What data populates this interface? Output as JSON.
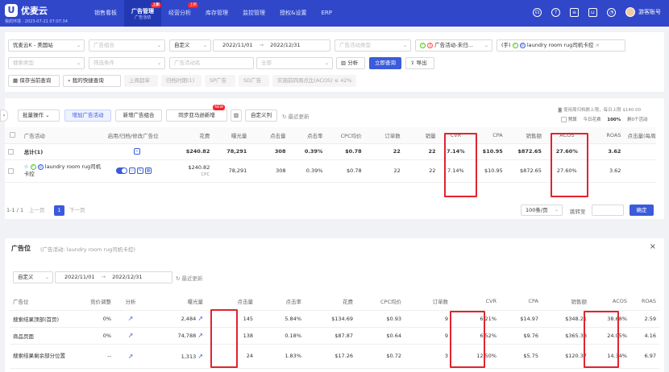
{
  "app": {
    "name": "优麦云",
    "subtitle": "我的环境 · 2023-07-21 07:07:34"
  },
  "nav": [
    {
      "label": "销售看板",
      "sub": "",
      "badge": ""
    },
    {
      "label": "广告管理",
      "sub": "广告活动",
      "badge": "上新"
    },
    {
      "label": "经营分析",
      "sub": "",
      "badge": "上新"
    },
    {
      "label": "库存管理",
      "sub": "",
      "badge": ""
    },
    {
      "label": "监控管理",
      "sub": "",
      "badge": ""
    },
    {
      "label": "授权&设置",
      "sub": "",
      "badge": ""
    },
    {
      "label": "ERP",
      "sub": "",
      "badge": ""
    }
  ],
  "user": {
    "name": "游客账号"
  },
  "filters": {
    "store": "优麦云K - 美国站",
    "portfolio_ph": "广告组合",
    "date_mode": "自定义",
    "date_start": "2022/11/01",
    "date_arrow": "→",
    "date_end": "2022/12/31",
    "ad_type_ph": "广告活动类型",
    "status_chip": "广告活动-未归…",
    "tag_chip_prefix": "(手)",
    "tag_chip": "laundry room rug司机卡控",
    "search_type_ph": "搜索类型",
    "search_cond_ph": "筛选条件",
    "campaign_ph": "广告活动名",
    "unit_ph": "全部",
    "analyze_btn": "分析",
    "query_btn": "立即查询",
    "export_btn": "导出",
    "save_btn": "保存当前查询",
    "my_query_btn": "我的快捷查询",
    "quick_tags": [
      "上周超单",
      "归档时期(1)",
      "SP广告",
      "SD广告",
      "实施前四周点比(ACOS) ≤ 42%"
    ]
  },
  "toolbar": {
    "batch_btn": "批量操作",
    "add_campaign_btn": "增加广告活动",
    "add_portfolio_btn": "新增广告组合",
    "sync_btn": "同步亚马逊新增",
    "sync_badge": "NEW",
    "custom_col_btn": "自定义列",
    "refresh": "最近更新",
    "right_line1": "使用周归档数上限，每日上限 $140.00",
    "right_label": "预算",
    "right_today": "今日花费",
    "right_percent": "100%",
    "right_count": "剩0个活动"
  },
  "main_table": {
    "headers": [
      "广告活动",
      "启用/归档/修改广告位",
      "花费",
      "曝光量",
      "点击量",
      "点击率",
      "CPC均价",
      "订单数",
      "销量",
      "CVR",
      "CPA",
      "销售额",
      "ACOS",
      "ROAS",
      "点击量(每周点)"
    ],
    "total_row": {
      "name": "总计(1)",
      "spend": "$240.82",
      "impr": "78,291",
      "clicks": "308",
      "ctr": "0.39%",
      "cpc": "$0.78",
      "orders": "22",
      "units": "22",
      "cvr": "7.14%",
      "cpa": "$10.95",
      "sales": "$872.65",
      "acos": "27.60%",
      "roas": "3.62"
    },
    "row": {
      "name": "laundry room rug司机卡控",
      "spend": "$240.82",
      "spend_sub": "CPC",
      "impr": "78,291",
      "clicks": "308",
      "ctr": "0.39%",
      "cpc": "$0.78",
      "orders": "22",
      "units": "22",
      "cvr": "7.14%",
      "cpa": "$10.95",
      "sales": "$872.65",
      "acos": "27.60%",
      "roas": "3.62"
    }
  },
  "pagination": {
    "range": "1-1 / 1",
    "prev": "上一页",
    "page": "1",
    "next": "下一页",
    "page_size": "100条/页",
    "jump_label": "跳转至",
    "confirm": "确定"
  },
  "placement": {
    "title": "广告位",
    "subtitle": "(广告活动: laundry room rug司机卡控)",
    "date_mode": "自定义",
    "date_start": "2022/11/01",
    "date_arrow": "→",
    "date_end": "2022/12/31",
    "refresh": "最近更新",
    "headers": [
      "广告位",
      "竞价调整",
      "分析",
      "曝光量",
      "点击量",
      "点击率",
      "花费",
      "CPC均价",
      "订单数",
      "CVR",
      "CPA",
      "销售额",
      "ACOS",
      "ROAS"
    ],
    "rows": [
      {
        "name": "搜索结果顶部(首页)",
        "bid": "0%",
        "impr": "2,484",
        "clicks": "145",
        "ctr": "5.84%",
        "spend": "$134.69",
        "cpc": "$0.93",
        "orders": "9",
        "cvr": "6.21%",
        "cpa": "$14.97",
        "sales": "$348.21",
        "acos": "38.68%",
        "roas": "2.59"
      },
      {
        "name": "商品页面",
        "bid": "0%",
        "impr": "74,788",
        "clicks": "138",
        "ctr": "0.18%",
        "spend": "$87.87",
        "cpc": "$0.64",
        "orders": "9",
        "cvr": "6.52%",
        "cpa": "$9.76",
        "sales": "$365.38",
        "acos": "24.05%",
        "roas": "4.16"
      },
      {
        "name": "搜索结果剩余部分位置",
        "bid": "--",
        "impr": "1,313",
        "clicks": "24",
        "ctr": "1.83%",
        "spend": "$17.26",
        "cpc": "$0.72",
        "orders": "3",
        "cvr": "12.50%",
        "cpa": "$5.75",
        "sales": "$120.37",
        "acos": "14.34%",
        "roas": "6.97"
      }
    ]
  }
}
